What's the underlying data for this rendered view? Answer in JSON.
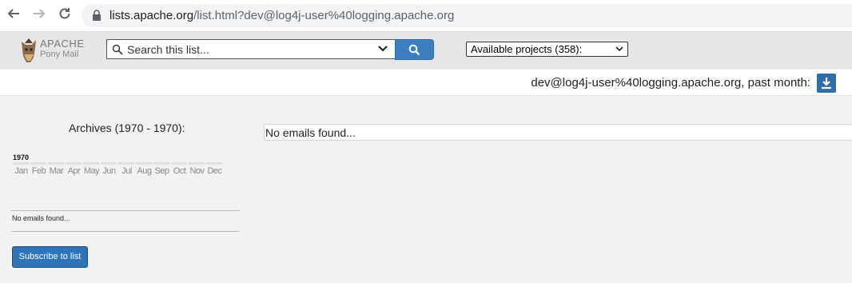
{
  "browser": {
    "url_host": "lists.apache.org",
    "url_path": "/list.html?dev@log4j-user%40logging.apache.org"
  },
  "app": {
    "logo_line1": "APACHE",
    "logo_line2": "Pony Mail",
    "search": {
      "placeholder": "Search this list..."
    },
    "projects_select": "Available projects (358):"
  },
  "list": {
    "title": "dev@log4j-user%40logging.apache.org, past month:"
  },
  "archives": {
    "title": "Archives (1970 - 1970):",
    "year": "1970",
    "months": [
      "Jan",
      "Feb",
      "Mar",
      "Apr",
      "May",
      "Jun",
      "Jul",
      "Aug",
      "Sep",
      "Oct",
      "Nov",
      "Dec"
    ],
    "no_emails": "No emails found...",
    "subscribe_label": "Subscribe to list"
  },
  "results": {
    "empty_text": "No emails found..."
  },
  "colors": {
    "accent": "#3c7ebf",
    "app_bar": "#e6e6e6",
    "page_bg": "#f2f2f2"
  }
}
